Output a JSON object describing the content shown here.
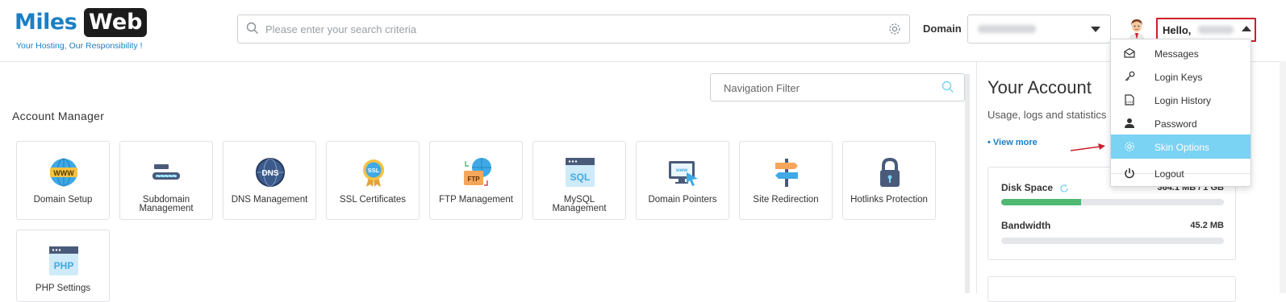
{
  "brand": {
    "logo_part1": "Miles",
    "logo_part2": "Web",
    "tagline": "Your Hosting, Our Responsibility !"
  },
  "header": {
    "search_placeholder": "Please enter your search criteria",
    "domain_label": "Domain",
    "hello_label": "Hello,"
  },
  "user_menu": {
    "items": [
      {
        "label": "Messages",
        "icon": "envelope-icon"
      },
      {
        "label": "Login Keys",
        "icon": "key-icon"
      },
      {
        "label": "Login History",
        "icon": "history-log-icon"
      },
      {
        "label": "Password",
        "icon": "user-icon"
      },
      {
        "label": "Skin Options",
        "icon": "gear-icon",
        "highlighted": true
      },
      {
        "label": "Logout",
        "icon": "power-icon"
      }
    ]
  },
  "main": {
    "nav_filter_placeholder": "Navigation Filter",
    "section_title": "Account Manager",
    "tiles": [
      {
        "label": "Domain Setup",
        "icon": "www-globe-icon"
      },
      {
        "label": "Subdomain Management",
        "icon": "subdomain-icon"
      },
      {
        "label": "DNS Management",
        "icon": "dns-globe-icon"
      },
      {
        "label": "SSL Certificates",
        "icon": "ssl-badge-icon"
      },
      {
        "label": "FTP Management",
        "icon": "ftp-folder-icon"
      },
      {
        "label": "MySQL Management",
        "icon": "sql-database-icon"
      },
      {
        "label": "Domain Pointers",
        "icon": "www-monitor-icon"
      },
      {
        "label": "Site Redirection",
        "icon": "signpost-icon"
      },
      {
        "label": "Hotlinks Protection",
        "icon": "padlock-icon"
      },
      {
        "label": "PHP Settings",
        "icon": "php-window-icon"
      }
    ]
  },
  "account": {
    "title": "Your Account",
    "subtitle": "Usage, logs and statistics",
    "view_more": "• View more",
    "disk_label": "Disk Space",
    "disk_value": "364.1 MB / 1 GB",
    "disk_fraction": 0.36,
    "bandwidth_label": "Bandwidth",
    "bandwidth_value": "45.2 MB",
    "bandwidth_fraction": 0.0
  },
  "colors": {
    "accent": "#1b7fc4",
    "highlight": "#7ad3f2",
    "progress": "#4fb873",
    "annotation_red": "#cc1f2d"
  }
}
